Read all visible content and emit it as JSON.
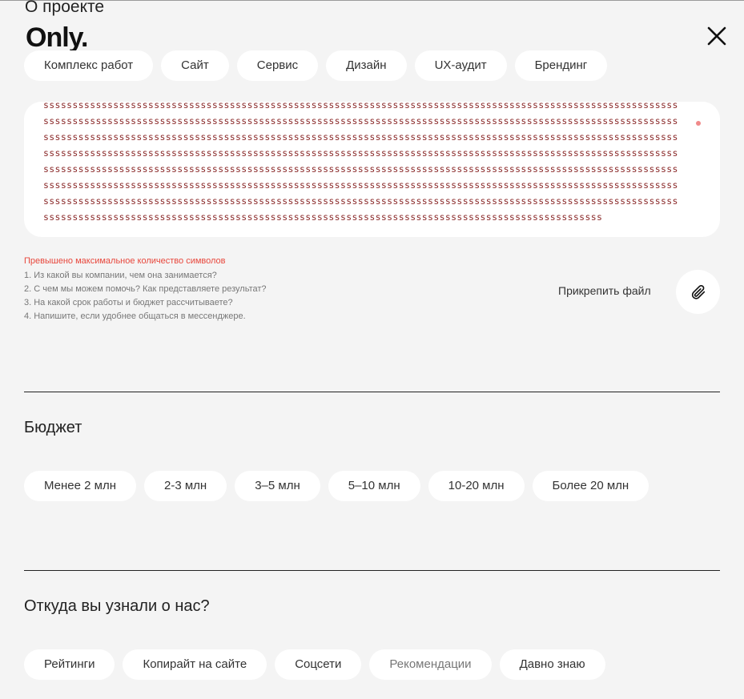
{
  "header": {
    "section_title": "О проекте",
    "logo": "Only.",
    "close_icon": "close-icon"
  },
  "project_types": [
    "Комплекс работ",
    "Сайт",
    "Сервис",
    "Дизайн",
    "UX-аудит",
    "Брендинг"
  ],
  "description": {
    "value": "sssssssssssssssssssssssssssssssssssssssssssssssssssssssssssssssssssssssssssssssssssssssssssssssssssssssssssssssssssssssssssssssssssssssssssssssssssssssssssssssssssssssssssssssssssssssssssssssssssssssssssssssssssssssssssssssssssssssssssssssssssssssssssssssssssssssssssssssssssssssssssssssssssssssssssssssssssssssssssssssssssssssssssssssssssssssssssssssssssssssssssssssssssssssssssssssssssssssssssssssssssssssssssssssssssssssssssssssssssssssssssssssssssssssssssssssssssssssssssssssssssssssssssssssssssssssssssssssssssssssssssssssssssssssssssssssssssssssssssssssssssssssssssssssssssssssssssssssssssssssssssssssssssssssssssssssssssssssssssssssssssssssssssssssssssssssssssssssssssssssssssssssssssssssssssssssssssssssssssssssssssssssssssssssssssssssssssssssssssssssssssssssssssssssssssssssssssssssssssssssssssssssssssssssssssssssssssssssssssssssssssssssssssssssssss",
    "error": "Превышено максимальное количество символов",
    "hints": [
      "1. Из какой вы компании, чем она занимается?",
      "2. С чем мы можем помочь? Как представляете результат?",
      "3. На какой срок работы и бюджет рассчитываете?",
      "4. Напишите, если удобнее общаться в мессенджере."
    ],
    "required_color": "#f08a8a",
    "error_color": "#e8473c"
  },
  "attach": {
    "label": "Прикрепить файл",
    "icon": "paperclip-icon"
  },
  "budget": {
    "title": "Бюджет",
    "options": [
      "Менее 2 млн",
      "2-3 млн",
      "3–5 млн",
      "5–10 млн",
      "10-20 млн",
      "Более 20 млн"
    ]
  },
  "source": {
    "title": "Откуда вы узнали о нас?",
    "options": [
      "Рейтинги",
      "Копирайт на сайте",
      "Соцсети",
      "Рекомендации",
      "Давно знаю"
    ]
  }
}
